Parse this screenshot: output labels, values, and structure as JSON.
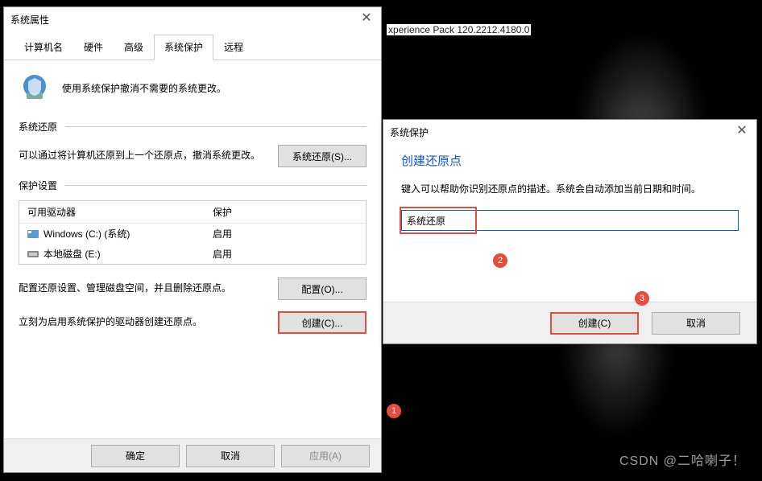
{
  "background": {
    "experience_text": "xperience Pack 120.2212.4180.0",
    "watermark": "CSDN @二哈喇子！"
  },
  "win1": {
    "title": "系统属性",
    "tabs": [
      "计算机名",
      "硬件",
      "高级",
      "系统保护",
      "远程"
    ],
    "active_tab_index": 3,
    "intro": "使用系统保护撤消不需要的系统更改。",
    "restore": {
      "title": "系统还原",
      "desc": "可以通过将计算机还原到上一个还原点，撤消系统更改。",
      "button": "系统还原(S)..."
    },
    "protect": {
      "title": "保护设置",
      "columns": [
        "可用驱动器",
        "保护"
      ],
      "drives": [
        {
          "name": "Windows (C:) (系统)",
          "status": "启用",
          "icon": "win-disk"
        },
        {
          "name": "本地磁盘 (E:)",
          "status": "启用",
          "icon": "local-disk"
        }
      ],
      "config_desc": "配置还原设置、管理磁盘空间，并且删除还原点。",
      "config_button": "配置(O)...",
      "create_desc": "立刻为启用系统保护的驱动器创建还原点。",
      "create_button": "创建(C)..."
    },
    "buttons": {
      "ok": "确定",
      "cancel": "取消",
      "apply": "应用(A)"
    }
  },
  "win2": {
    "title": "系统保护",
    "heading": "创建还原点",
    "desc": "键入可以帮助你识别还原点的描述。系统会自动添加当前日期和时间。",
    "input_value": "系统还原",
    "buttons": {
      "create": "创建(C)",
      "cancel": "取消"
    }
  },
  "callouts": {
    "c1": "1",
    "c2": "2",
    "c3": "3"
  }
}
